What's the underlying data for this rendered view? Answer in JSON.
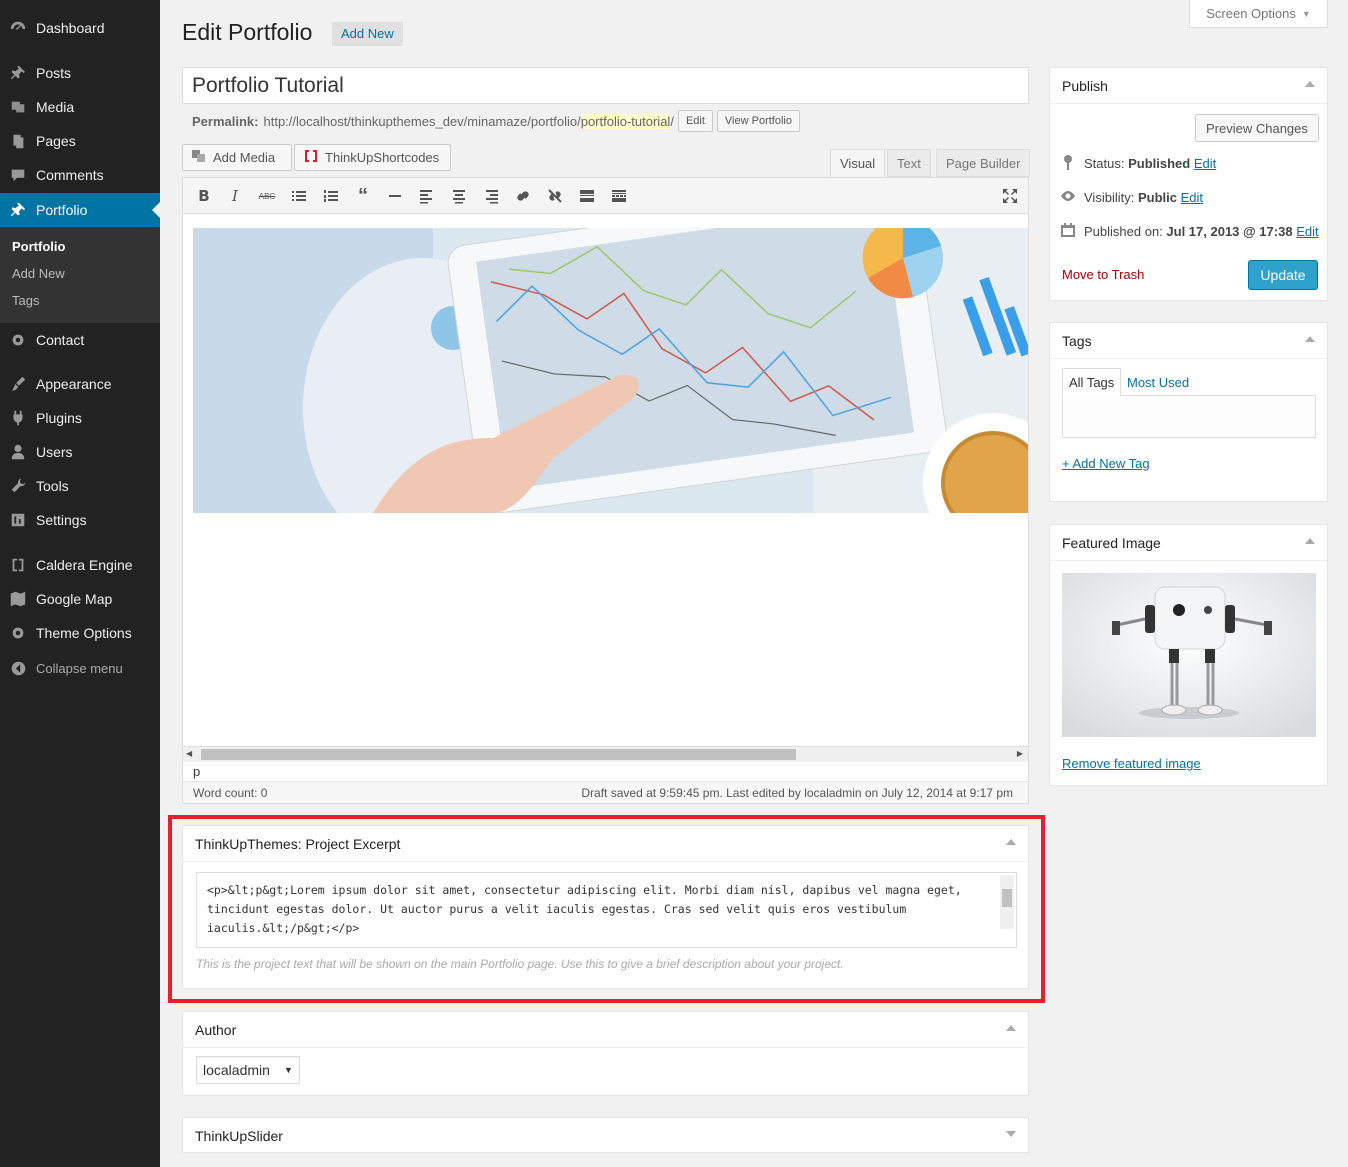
{
  "sidebar": {
    "items": [
      {
        "label": "Dashboard",
        "icon": "dashboard-icon"
      },
      {
        "label": "Posts",
        "icon": "pin-icon"
      },
      {
        "label": "Media",
        "icon": "media-icon"
      },
      {
        "label": "Pages",
        "icon": "pages-icon"
      },
      {
        "label": "Comments",
        "icon": "comment-icon"
      },
      {
        "label": "Portfolio",
        "icon": "pin-icon"
      },
      {
        "label": "Contact",
        "icon": "gear-icon"
      },
      {
        "label": "Appearance",
        "icon": "brush-icon"
      },
      {
        "label": "Plugins",
        "icon": "plugin-icon"
      },
      {
        "label": "Users",
        "icon": "user-icon"
      },
      {
        "label": "Tools",
        "icon": "wrench-icon"
      },
      {
        "label": "Settings",
        "icon": "settings-icon"
      },
      {
        "label": "Caldera Engine",
        "icon": "bracket-icon"
      },
      {
        "label": "Google Map",
        "icon": "map-icon"
      },
      {
        "label": "Theme Options",
        "icon": "gear-icon"
      }
    ],
    "submenu": [
      "Portfolio",
      "Add New",
      "Tags"
    ],
    "collapse_label": "Collapse menu"
  },
  "header": {
    "title": "Edit Portfolio",
    "add_new": "Add New",
    "screen_options": "Screen Options"
  },
  "post": {
    "title": "Portfolio Tutorial",
    "permalink_label": "Permalink:",
    "permalink_base": "http://localhost/thinkupthemes_dev/minamaze/portfolio/",
    "permalink_slug": "portfolio-tutorial",
    "permalink_end": "/",
    "edit_btn": "Edit",
    "view_btn": "View Portfolio"
  },
  "editor": {
    "add_media": "Add Media",
    "shortcodes": "ThinkUpShortcodes",
    "tabs": [
      "Visual",
      "Text",
      "Page Builder"
    ],
    "path": "p",
    "word_count": "Word count: 0",
    "draft_status": "Draft saved at 9:59:45 pm. Last edited by localadmin on July 12, 2014 at 9:17 pm"
  },
  "excerpt": {
    "title": "ThinkUpThemes: Project Excerpt",
    "value": "<p>&lt;p&gt;Lorem ipsum dolor sit amet, consectetur adipiscing elit. Morbi diam nisl, dapibus vel magna eget, tincidunt egestas dolor. Ut auctor purus a velit iaculis egestas. Cras sed velit quis eros vestibulum iaculis.&lt;/p&gt;</p>",
    "description": "This is the project text that will be shown on the main Portfolio page. Use this to give a brief description about your project."
  },
  "author": {
    "title": "Author",
    "selected": "localadmin"
  },
  "slider": {
    "title": "ThinkUpSlider"
  },
  "publish": {
    "title": "Publish",
    "preview": "Preview Changes",
    "status_label": "Status:",
    "status_value": "Published",
    "visibility_label": "Visibility:",
    "visibility_value": "Public",
    "published_label": "Published on:",
    "published_value": "Jul 17, 2013 @ 17:38",
    "edit": "Edit",
    "trash": "Move to Trash",
    "update": "Update"
  },
  "tags": {
    "title": "Tags",
    "tab_all": "All Tags",
    "tab_used": "Most Used",
    "add_new": "+ Add New Tag"
  },
  "featured": {
    "title": "Featured Image",
    "remove": "Remove featured image"
  },
  "colors": {
    "sidebar_bg": "#222222",
    "accent": "#0074a2",
    "update_button": "#2ea2cc",
    "highlight": "#e4202e"
  }
}
